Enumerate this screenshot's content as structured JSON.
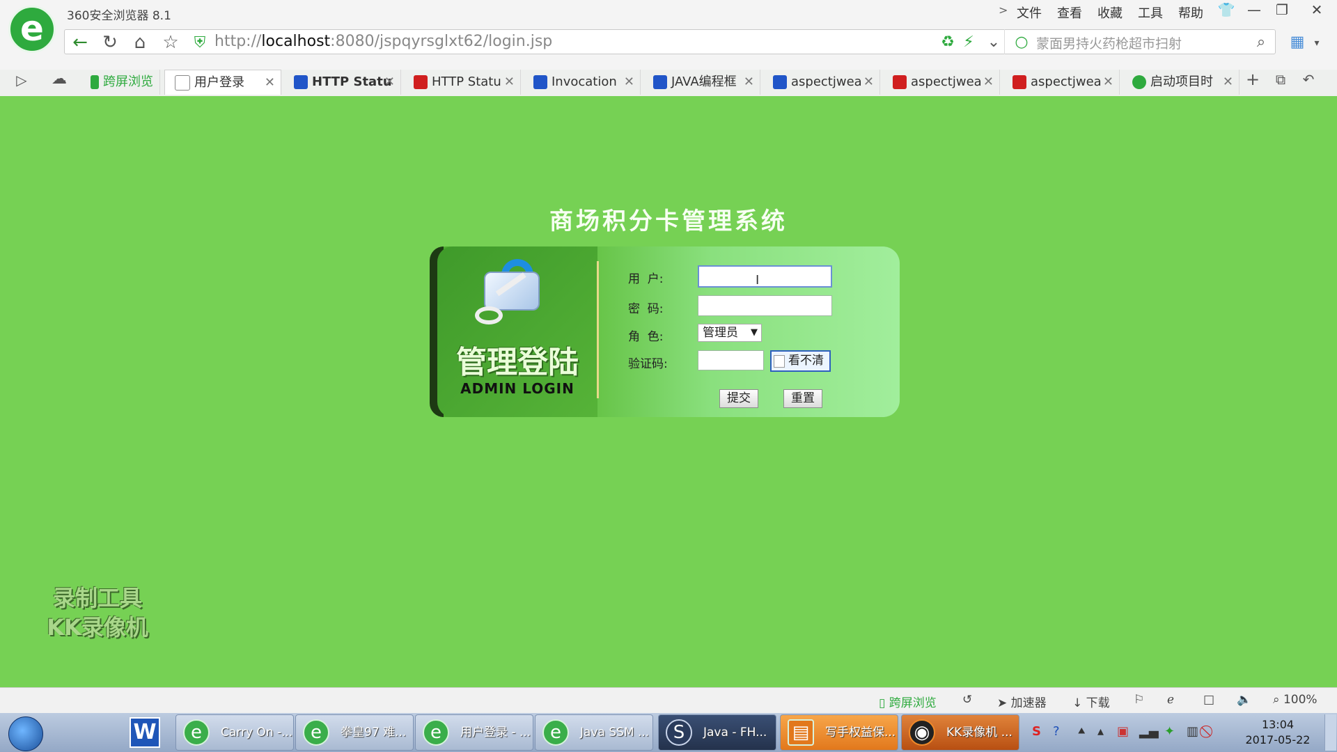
{
  "browser": {
    "app_title": "360安全浏览器 8.1",
    "menu": [
      "文件",
      "查看",
      "收藏",
      "工具",
      "帮助"
    ],
    "url_prefix": "http://",
    "url_host": "localhost",
    "url_rest": ":8080/jspqyrsglxt62/login.jsp",
    "search_placeholder": "蒙面男持火药枪超市扫射",
    "tabs": [
      {
        "label": "跨屏浏览",
        "color": "#2eaa3e"
      },
      {
        "label": "用户登录",
        "color": "#888888"
      },
      {
        "label": "HTTP Statu",
        "color": "#2055c8"
      },
      {
        "label": "HTTP Statu",
        "color": "#d01f1f"
      },
      {
        "label": "Invocation",
        "color": "#2055c8"
      },
      {
        "label": "JAVA编程框",
        "color": "#2055c8"
      },
      {
        "label": "aspectjwea",
        "color": "#2055c8"
      },
      {
        "label": "aspectjwea",
        "color": "#d01f1f"
      },
      {
        "label": "aspectjwea",
        "color": "#d01f1f"
      },
      {
        "label": "启动项目时",
        "color": "#2eaa3e"
      }
    ],
    "status": {
      "cross_screen": "跨屏浏览",
      "accelerator": "加速器",
      "download": "下载",
      "zoom": "100%"
    }
  },
  "login": {
    "system_title": "商场积分卡管理系统",
    "panel_title_cn": "管理登陆",
    "panel_title_en": "ADMIN LOGIN",
    "labels": {
      "user": "用  户:",
      "password": "密  码:",
      "role": "角  色:",
      "captcha": "验证码:"
    },
    "role_selected": "管理员",
    "captcha_alt": "看不清",
    "submit": "提交",
    "reset": "重置"
  },
  "watermark": {
    "line1": "录制工具",
    "line2": "KK录像机"
  },
  "taskbar": {
    "tasks": [
      {
        "label": "Carry On -..."
      },
      {
        "label": "拳皇97 难..."
      },
      {
        "label": "用户登录 - ..."
      },
      {
        "label": "Java SSM ..."
      },
      {
        "label": "Java - FH..."
      },
      {
        "label": "写手权益保..."
      },
      {
        "label": "KK录像机 ..."
      }
    ],
    "time": "13:04",
    "date": "2017-05-22"
  }
}
